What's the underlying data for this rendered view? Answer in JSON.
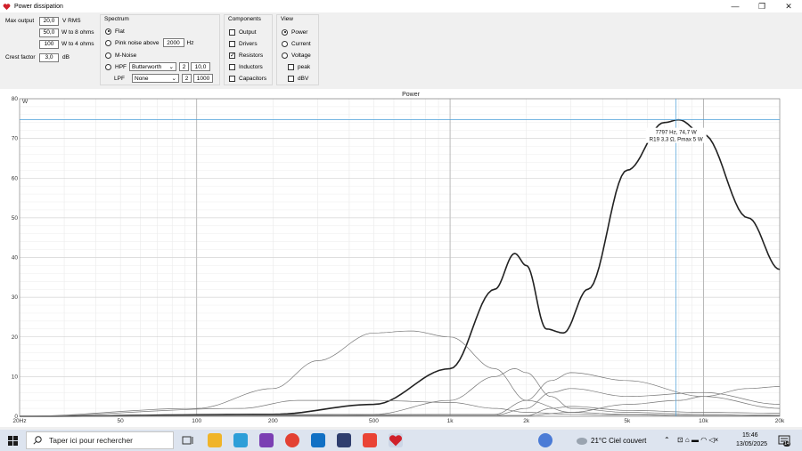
{
  "window": {
    "title": "Power dissipation",
    "minimize_glyph": "—",
    "maximize_glyph": "❐",
    "close_glyph": "✕"
  },
  "settings": {
    "max_output_label": "Max output",
    "max_output_value": "20,0",
    "max_output_unit": "V RMS",
    "w8_value": "50,0",
    "w8_label": "W to 8 ohms",
    "w4_value": "100",
    "w4_label": "W to 4 ohms",
    "crest_label": "Crest factor",
    "crest_value": "3,0",
    "crest_unit": "dB"
  },
  "spectrum": {
    "title": "Spectrum",
    "flat": "Flat",
    "pink": "Pink noise above",
    "pink_value": "2000",
    "pink_unit": "Hz",
    "mnoise": "M-Noise",
    "hpf": "HPF",
    "hpf_type": "Butterworth",
    "hpf_order": "2",
    "hpf_freq": "10,0",
    "lpf": "LPF",
    "lpf_type": "None",
    "lpf_order": "2",
    "lpf_freq": "1000"
  },
  "components": {
    "title": "Components",
    "output": "Output",
    "drivers": "Drivers",
    "resistors": "Resistors",
    "inductors": "Inductors",
    "capacitors": "Capacitors",
    "resistors_checked": true
  },
  "view": {
    "title": "View",
    "power": "Power",
    "current": "Current",
    "voltage": "Voltage",
    "peak": "peak",
    "dbv": "dBV"
  },
  "chart_data": {
    "type": "line",
    "title": "Power",
    "ylabel": "W",
    "xscale": "log",
    "xlim": [
      20,
      20000
    ],
    "ylim": [
      0,
      80
    ],
    "x_ticks": [
      20,
      50,
      100,
      200,
      500,
      1000,
      2000,
      5000,
      10000,
      20000
    ],
    "x_tick_labels": [
      "20Hz",
      "50",
      "100",
      "200",
      "500",
      "1k",
      "2k",
      "5k",
      "10k",
      "20k"
    ],
    "y_ticks": [
      0,
      10,
      20,
      30,
      40,
      50,
      60,
      70,
      80
    ],
    "y_tick_labels": [
      "0",
      "10",
      "20",
      "30",
      "40",
      "50",
      "60",
      "70",
      "80"
    ],
    "grid": true,
    "cursor": {
      "x": 7797,
      "y": 74.7,
      "line1": "7797 Hz, 74,7 W",
      "line2": "R19 3,3 Ω, Pmax 5 W"
    },
    "colors": {
      "main": "#222222",
      "thin": "#777777",
      "cursor": "#4a9fd8",
      "grid": "#c8c8c8"
    },
    "series": [
      {
        "x": [
          20,
          200,
          500,
          1000,
          1500,
          1800,
          2000,
          2400,
          2800,
          3500,
          5000,
          7000,
          8000,
          10000,
          15000,
          20000
        ],
        "y": [
          0,
          0.5,
          3,
          12,
          32,
          41,
          38,
          22,
          21,
          32,
          62,
          74,
          74.7,
          71,
          50,
          37
        ]
      },
      {
        "x": [
          20,
          100,
          200,
          300,
          500,
          700,
          1000,
          1500,
          2000,
          3000,
          5000,
          10000,
          20000
        ],
        "y": [
          0,
          2,
          7,
          14,
          21,
          21.5,
          20,
          12,
          4,
          1,
          0.5,
          0.2,
          0.1
        ]
      },
      {
        "x": [
          20,
          150,
          250,
          500,
          1000,
          1500,
          2000,
          3000,
          5000,
          10000,
          20000
        ],
        "y": [
          0,
          2,
          4,
          4,
          3.5,
          2,
          1,
          0.5,
          0.3,
          0.2,
          0.1
        ]
      },
      {
        "x": [
          20,
          500,
          1000,
          1500,
          1800,
          2000,
          2500,
          3000,
          5000,
          10000,
          20000
        ],
        "y": [
          0,
          0.5,
          4,
          10,
          12,
          11,
          5,
          2,
          1,
          0.5,
          0.3
        ]
      },
      {
        "x": [
          20,
          1500,
          2000,
          2500,
          3000,
          5000,
          10000,
          20000
        ],
        "y": [
          0,
          0.5,
          4,
          9,
          11,
          9,
          5,
          2
        ]
      },
      {
        "x": [
          20,
          1500,
          2000,
          2500,
          3000,
          5000,
          10000,
          20000
        ],
        "y": [
          0,
          0.3,
          2,
          6,
          7,
          5,
          6,
          3
        ]
      },
      {
        "x": [
          20,
          2000,
          3000,
          5000,
          8000,
          10000,
          15000,
          20000
        ],
        "y": [
          0,
          0.2,
          1,
          3,
          4,
          5,
          7,
          7.5
        ]
      },
      {
        "x": [
          20,
          2000,
          2500,
          3000,
          5000,
          10000,
          20000
        ],
        "y": [
          0,
          0.2,
          2,
          2.5,
          1.5,
          1,
          0.8
        ]
      }
    ]
  },
  "taskbar": {
    "search_placeholder": "Taper ici pour rechercher",
    "weather": "21°C  Ciel couvert",
    "time": "15:46",
    "date": "13/05/2025",
    "notif_count": "14"
  }
}
